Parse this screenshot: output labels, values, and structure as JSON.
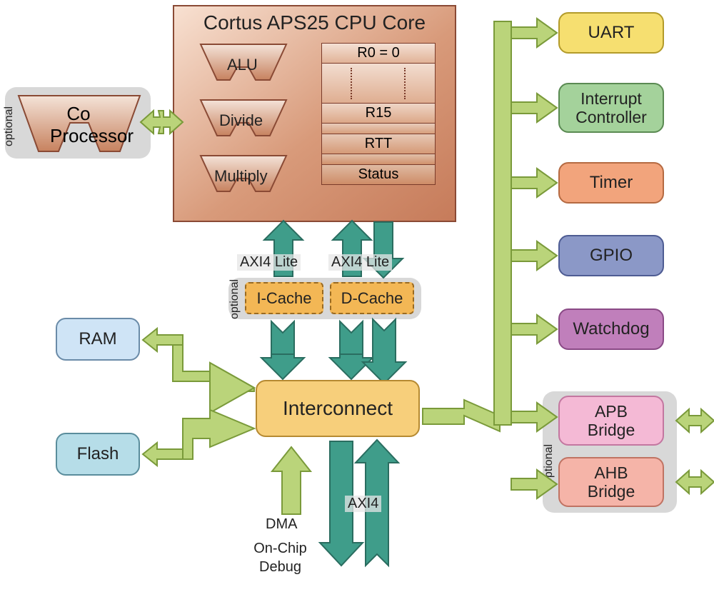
{
  "cpu": {
    "title": "Cortus APS25 CPU Core",
    "units": {
      "alu": "ALU",
      "divide": "Divide",
      "multiply": "Multiply"
    },
    "regs": {
      "r0": "R0 = 0",
      "r15": "R15",
      "rtt": "RTT",
      "status": "Status"
    }
  },
  "coprocessor": {
    "label1": "Co",
    "label2": "Processor",
    "optional": "optional"
  },
  "caches": {
    "icache": "I-Cache",
    "dcache": "D-Cache",
    "optional": "optional"
  },
  "bus": {
    "axi4lite_left": "AXI4 Lite",
    "axi4lite_right": "AXI4 Lite",
    "axi4": "AXI4"
  },
  "interconnect": "Interconnect",
  "dma": {
    "label": "DMA",
    "onchipdebug1": "On-Chip",
    "onchipdebug2": "Debug"
  },
  "memory": {
    "ram": "RAM",
    "flash": "Flash"
  },
  "periph": {
    "uart": "UART",
    "interrupt1": "Interrupt",
    "interrupt2": "Controller",
    "timer": "Timer",
    "gpio": "GPIO",
    "watchdog": "Watchdog",
    "apb1": "APB",
    "apb2": "Bridge",
    "ahb1": "AHB",
    "ahb2": "Bridge",
    "bridges_optional": "optional"
  },
  "colors": {
    "uart": "#f6df70",
    "interrupt": "#a4d29b",
    "timer": "#f2a47c",
    "gpio": "#8b98c7",
    "watchdog": "#c07fbb",
    "apb": "#f4b9d5",
    "ahb": "#f5b4a8",
    "ram": "#cfe4f6",
    "flash": "#b6dde8",
    "intercon": "#f7cf7b",
    "cache": "#f3b755",
    "green_arrow": "#bad47a",
    "green_arrow_stroke": "#7a9a3a",
    "teal_arrow": "#3f9d8a",
    "teal_arrow_stroke": "#2a6d60"
  }
}
